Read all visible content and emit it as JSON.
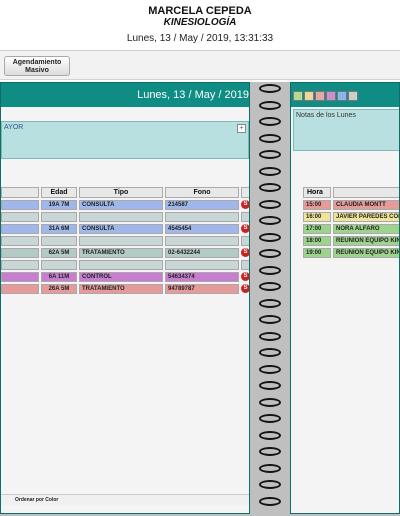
{
  "header": {
    "name": "MARCELA CEPEDA",
    "specialty": "KINESIOLOGÍA",
    "datetime": "Lunes, 13 / May / 2019, 13:31:33"
  },
  "toolbar": {
    "masivo_line1": "Agendamiento",
    "masivo_line2": "Masivo"
  },
  "left_page": {
    "date_title": "Lunes, 13 / May / 2019",
    "note_text": "AYOR",
    "note_plus": "+",
    "columns": [
      "Edad",
      "Tipo",
      "Fono"
    ],
    "rows": [
      {
        "age": "19A 7M",
        "tipo": "CONSULTA",
        "fono": "214587",
        "color": "#9fb7ea",
        "icon": "S"
      },
      {
        "age": "",
        "tipo": "",
        "fono": "",
        "color": "#c8d6d6",
        "icon": ""
      },
      {
        "age": "31A 6M",
        "tipo": "CONSULTA",
        "fono": "4545454",
        "color": "#9fb7ea",
        "icon": "S"
      },
      {
        "age": "",
        "tipo": "",
        "fono": "",
        "color": "#c8d6d6",
        "icon": ""
      },
      {
        "age": "62A 5M",
        "tipo": "TRATAMIENTO",
        "fono": "02-6432244",
        "color": "#b3cbc5",
        "icon": "S"
      },
      {
        "age": "",
        "tipo": "",
        "fono": "",
        "color": "#c8d6d6",
        "icon": ""
      },
      {
        "age": "6A 11M",
        "tipo": "CONTROL",
        "fono": "54634374",
        "color": "#c87ed0",
        "icon": "S"
      },
      {
        "age": "26A 5M",
        "tipo": "TRATAMIENTO",
        "fono": "94789787",
        "color": "#e79a9a",
        "icon": "S"
      }
    ],
    "footer": "Ordenar por Color"
  },
  "right_page": {
    "swatches": [
      "#b5d98f",
      "#e9d99a",
      "#e7a5a5",
      "#c78fd0",
      "#8fb4e9",
      "#c6d0d0"
    ],
    "note_title": "Notas de los Lunes",
    "hora_label": "Hora",
    "appointments": [
      {
        "time": "15:00",
        "name": "CLAUDIA MONTT",
        "color": "#e79a9a"
      },
      {
        "time": "16:00",
        "name": "JAVIER PAREDES CONT",
        "color": "#efe49a"
      },
      {
        "time": "17:00",
        "name": "NORA ALFARO",
        "color": "#9cd48c"
      },
      {
        "time": "18:00",
        "name": "REUNION EQUIPO KINES",
        "color": "#9cd48c"
      },
      {
        "time": "19:00",
        "name": "REUNION EQUIPO KINE",
        "color": "#9cd48c"
      }
    ]
  }
}
